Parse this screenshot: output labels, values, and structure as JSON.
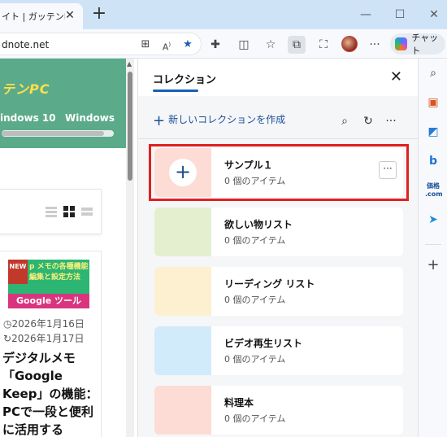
{
  "browser": {
    "tab_title": "ガッテンPC",
    "tab_title_prefix": "イト | ",
    "address": "dnote.net",
    "chat_label": "チャット"
  },
  "web": {
    "logo": "テンPC",
    "nav": [
      "indows 10",
      "Windows"
    ],
    "date_published": "2026年1月16日",
    "date_updated": "2026年1月17日",
    "thumb_new": "NEW",
    "thumb_text_1": "p メモの各種機能",
    "thumb_text_2": "編集と設定方法",
    "thumb_banner": "Google ツール",
    "article_title": "デジタルメモ「Google Keep」の機能：PCで一段と便利に活用する"
  },
  "collections": {
    "title": "コレクション",
    "create_label": "新しいコレクションを作成",
    "more_label": "···",
    "items": [
      {
        "name": "サンプル１",
        "count": "0 個のアイテム",
        "color": "#fcdcd4"
      },
      {
        "name": "欲しい物リスト",
        "count": "0 個のアイテム",
        "color": "#e4efd0"
      },
      {
        "name": "リーディング リスト",
        "count": "0 個のアイテム",
        "color": "#fdf0d0"
      },
      {
        "name": "ビデオ再生リスト",
        "count": "0 個のアイテム",
        "color": "#d2ebfa"
      },
      {
        "name": "料理本",
        "count": "0 個のアイテム",
        "color": "#fcdcd4"
      }
    ]
  },
  "colors": {
    "header_green": "#5bab8b",
    "highlight_red": "#e02020",
    "accent_blue": "#1a5fb4"
  }
}
